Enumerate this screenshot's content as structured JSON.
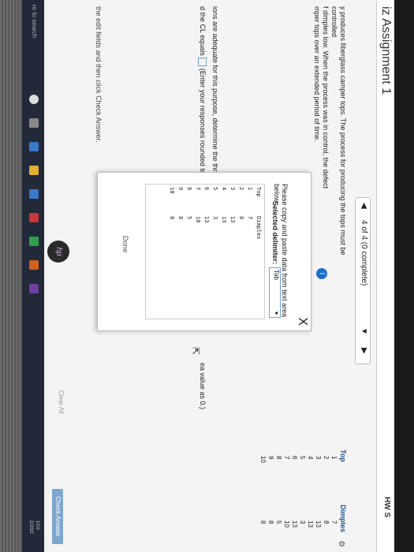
{
  "app": {
    "title": "iz Assignment 1",
    "hw_score": "HW S",
    "question_nav": "4 of 4 (0 complete)"
  },
  "problem": {
    "lines": [
      "y produces fiberglass camper tops. The process for producing the tops must be controlled",
      "f dimples low. When the process was in control, the defect",
      "mper tops over an extended period of time."
    ]
  },
  "modal": {
    "close": "X",
    "instruction": "Please copy and paste data from text area below",
    "delimiter_label": "Selected delimiter:",
    "delimiter_value": "Tab",
    "table": {
      "headers": [
        "Top",
        "Dimples"
      ],
      "rows": [
        [
          "1",
          "7"
        ],
        [
          "2",
          "8"
        ],
        [
          "3",
          "13"
        ],
        [
          "4",
          "13"
        ],
        [
          "5",
          "3"
        ],
        [
          "6",
          "13"
        ],
        [
          "7",
          "10"
        ],
        [
          "8",
          "5"
        ],
        [
          "9",
          "8"
        ],
        [
          "10",
          "8"
        ]
      ]
    },
    "done": "Done"
  },
  "right_table": {
    "headers": [
      "Top",
      "Dimples"
    ],
    "rows": [
      [
        "1",
        "7"
      ],
      [
        "2",
        "8"
      ],
      [
        "3",
        "13"
      ],
      [
        "4",
        "13"
      ],
      [
        "5",
        "3"
      ],
      [
        "6",
        "13"
      ],
      [
        "7",
        "10"
      ],
      [
        "8",
        "5"
      ],
      [
        "9",
        "8"
      ],
      [
        "10",
        "8"
      ]
    ]
  },
  "question": {
    "prompt_2": "ions are adequate for this purpose, determine the three-sigma",
    "prompt_3a": "d the CL",
    "prompt_3b": "equals",
    "prompt_3c": "(Enter your responses rounded to two d",
    "right_note": "ea value as 0.)",
    "enter_note": "the edit fields and then click Check Answer."
  },
  "buttons": {
    "clear_all": "Clear All",
    "check_answer": "Check Answer"
  },
  "taskbar": {
    "search": "re to search",
    "clock_time": "10:0",
    "clock_date": "2/20/2"
  },
  "brand": {
    "logo": "hp"
  }
}
